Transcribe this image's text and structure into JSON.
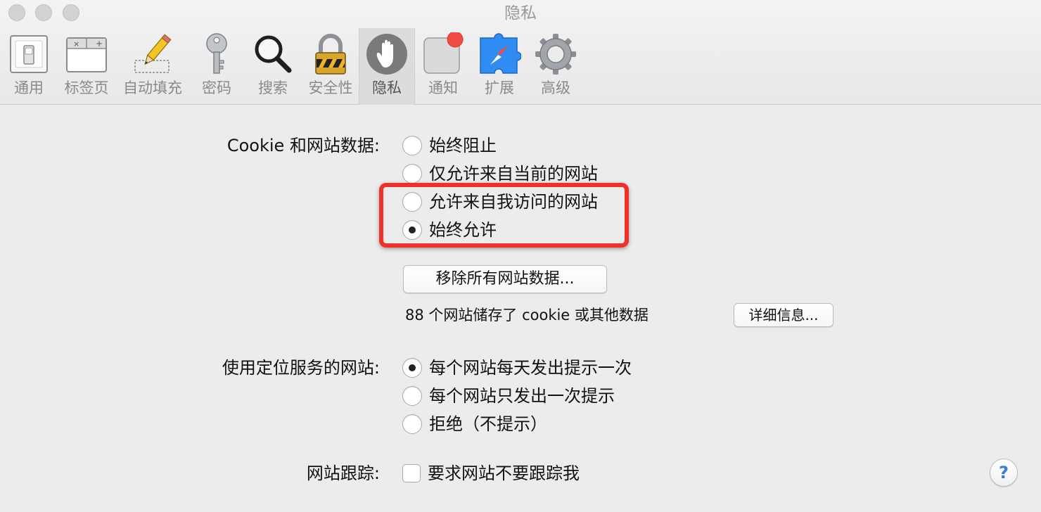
{
  "window": {
    "title": "隐私"
  },
  "toolbar": {
    "items": [
      {
        "label": "通用",
        "icon": "switch-icon"
      },
      {
        "label": "标签页",
        "icon": "tabs-icon"
      },
      {
        "label": "自动填充",
        "icon": "pencil-icon"
      },
      {
        "label": "密码",
        "icon": "key-icon"
      },
      {
        "label": "搜索",
        "icon": "magnifier-icon"
      },
      {
        "label": "安全性",
        "icon": "padlock-icon"
      },
      {
        "label": "隐私",
        "icon": "hand-icon",
        "active": true
      },
      {
        "label": "通知",
        "icon": "notification-icon"
      },
      {
        "label": "扩展",
        "icon": "compass-puzzle-icon"
      },
      {
        "label": "高级",
        "icon": "gear-icon"
      }
    ]
  },
  "cookies": {
    "label": "Cookie 和网站数据:",
    "options": [
      {
        "label": "始终阻止",
        "selected": false
      },
      {
        "label": "仅允许来自当前的网站",
        "selected": false
      },
      {
        "label": "允许来自我访问的网站",
        "selected": false
      },
      {
        "label": "始终允许",
        "selected": true
      }
    ],
    "remove_button": "移除所有网站数据...",
    "stored_info": "88 个网站储存了 cookie 或其他数据",
    "details_button": "详细信息..."
  },
  "location": {
    "label": "使用定位服务的网站:",
    "options": [
      {
        "label": "每个网站每天发出提示一次",
        "selected": true
      },
      {
        "label": "每个网站只发出一次提示",
        "selected": false
      },
      {
        "label": "拒绝（不提示）",
        "selected": false
      }
    ]
  },
  "tracking": {
    "label": "网站跟踪:",
    "checkbox_label": "要求网站不要跟踪我",
    "checked": false
  },
  "help": {
    "label": "?"
  },
  "colors": {
    "highlight": "#f0302b",
    "notification_badge": "#f24a45",
    "safari_blue": "#2f8cf3"
  }
}
